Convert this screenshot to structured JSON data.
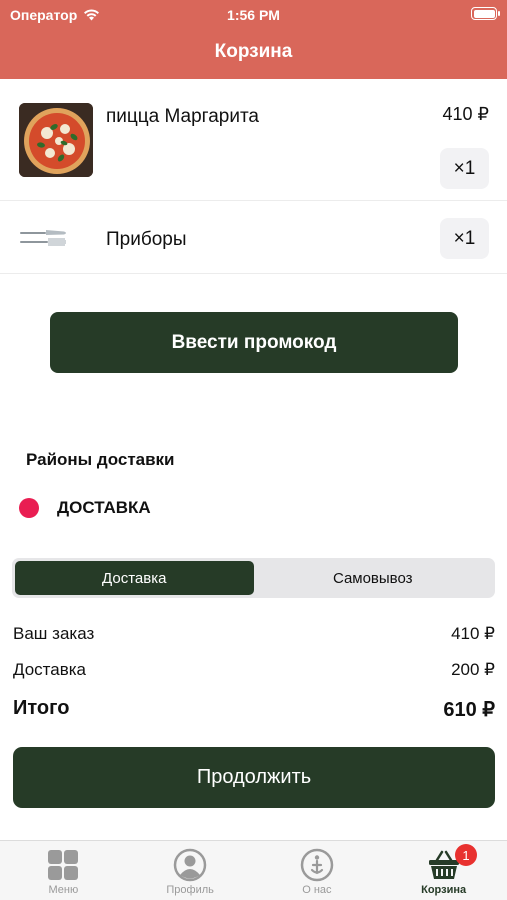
{
  "status_bar": {
    "carrier": "Оператор",
    "time": "1:56 PM"
  },
  "header": {
    "title": "Корзина"
  },
  "cart": {
    "items": [
      {
        "name": "пицца Маргарита",
        "price": "410 ₽",
        "qty": "×1",
        "icon": "pizza-image"
      },
      {
        "name": "Приборы",
        "qty": "×1",
        "icon": "cutlery-icon"
      }
    ],
    "promo_button": "Ввести промокод"
  },
  "delivery_zones": {
    "title": "Районы доставки",
    "zone": {
      "label": "ДОСТАВКА",
      "color": "#e91e52"
    }
  },
  "delivery_mode": {
    "options": [
      "Доставка",
      "Самовывоз"
    ],
    "selected": "Доставка"
  },
  "summary": {
    "order_label": "Ваш заказ",
    "order_value": "410 ₽",
    "delivery_label": "Доставка",
    "delivery_value": "200 ₽",
    "total_label": "Итого",
    "total_value": "610 ₽"
  },
  "continue_button": "Продолжить",
  "tabbar": {
    "tabs": [
      {
        "label": "Меню",
        "icon": "grid-icon"
      },
      {
        "label": "Профиль",
        "icon": "profile-icon"
      },
      {
        "label": "О нас",
        "icon": "info-icon"
      },
      {
        "label": "Корзина",
        "icon": "basket-icon"
      }
    ],
    "active": "Корзина",
    "cart_badge": "1"
  },
  "colors": {
    "header": "#d9675a",
    "accent": "#263b27",
    "badge": "#e8312f"
  }
}
